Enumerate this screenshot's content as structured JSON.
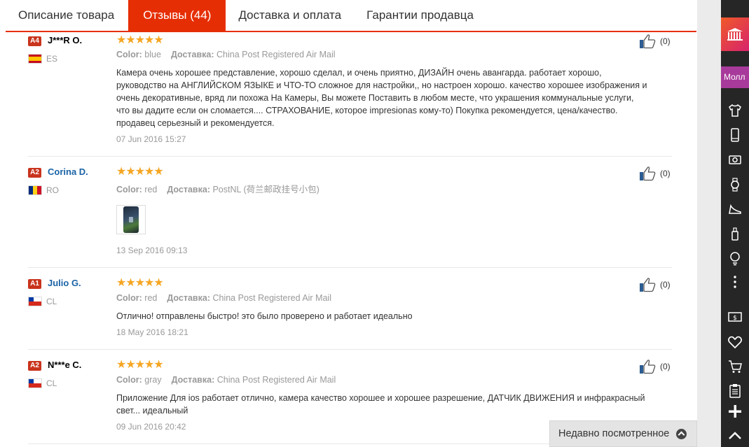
{
  "tabs": [
    {
      "label": "Описание товара"
    },
    {
      "label": "Отзывы (44)"
    },
    {
      "label": "Доставка и оплата"
    },
    {
      "label": "Гарантии продавца"
    }
  ],
  "labels": {
    "color": "Color:",
    "delivery": "Доставка:"
  },
  "reviews": [
    {
      "badge": "A4",
      "name": "J***R O.",
      "country": "ES",
      "stars": "★★★★★",
      "color": "blue",
      "delivery": "China Post Registered Air Mail",
      "text": "Камера очень хорошее представление, хорошо сделал, и очень приятно, ДИЗАЙН очень авангарда. работает хорошо, руководство на АНГЛИЙСКОМ ЯЗЫКЕ и ЧТО-ТО сложное для настройки,, но настроен хорошо. качество хорошее изображения и очень декоративные, вряд ли похожа На Камеры, Вы можете Поставить в любом месте, что украшения коммунальные услуги, что вы дадите если он сломается.... СТРАХОВАНИЕ, которое impresionas кому-то) Покупка рекомендуется, цена/качество. продавец серьезный и рекомендуется.",
      "date": "07 Jun 2016 15:27",
      "likes": "(0)"
    },
    {
      "badge": "A2",
      "name": "Corina D.",
      "country": "RO",
      "stars": "★★★★★",
      "color": "red",
      "delivery": "PostNL (荷兰邮政挂号小包)",
      "text": "",
      "date": "13 Sep 2016 09:13",
      "likes": "(0)"
    },
    {
      "badge": "A1",
      "name": "Julio G.",
      "country": "CL",
      "stars": "★★★★★",
      "color": "red",
      "delivery": "China Post Registered Air Mail",
      "text": "Отлично! отправлены быстро! это было проверено и работает идеально",
      "date": "18 May 2016 18:21",
      "likes": "(0)"
    },
    {
      "badge": "A2",
      "name": "N***e C.",
      "country": "CL",
      "stars": "★★★★★",
      "color": "gray",
      "delivery": "China Post Registered Air Mail",
      "text": "Приложение Для ios работает отлично, камера качество хорошее и хорошее разрешение, ДАТЧИК ДВИЖЕНИЯ и инфракрасный свет... идеальный",
      "date": "09 Jun 2016 20:42",
      "likes": "(0)"
    }
  ],
  "recent": {
    "label": "Недавно посмотренное"
  },
  "rail": {
    "mall_label": "Молл",
    "icons": [
      "store-logo-icon",
      "tshirt-icon",
      "phone-icon",
      "camera-icon",
      "watch-icon",
      "shoe-icon",
      "bottle-icon",
      "bulb-icon",
      "more-icon",
      "coupon-icon",
      "heart-icon",
      "cart-icon",
      "clipboard-icon",
      "plus-icon",
      "arrow-up-icon"
    ]
  },
  "colors": {
    "accent": "#e62e04",
    "star": "#f5a623",
    "link": "#1a63a6",
    "badge": "#c9341d",
    "rail": "#262626",
    "mall": "#a73a9a"
  }
}
